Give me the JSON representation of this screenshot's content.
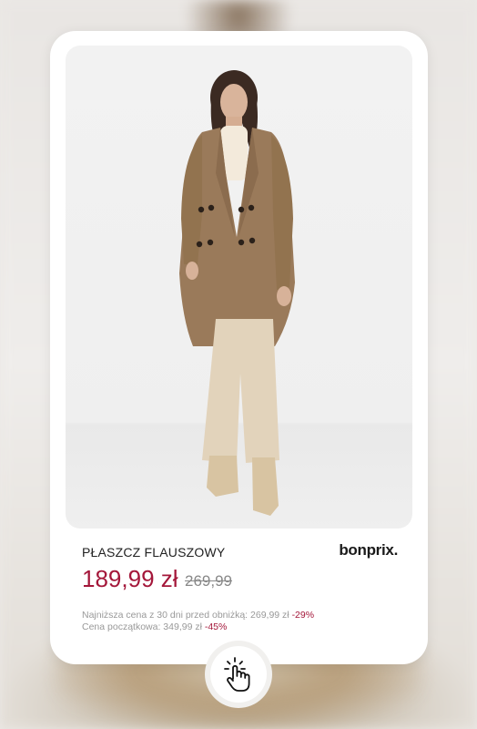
{
  "product": {
    "name": "PŁASZCZ FLAUSZOWY",
    "brand": "bonprix.",
    "price": "189,99 zł",
    "old_price": "269,99",
    "lowest_price_label": "Najniższa cena z 30 dni  przed obniżką: 269,99 zł",
    "lowest_price_discount": "-29%",
    "initial_price_label": "Cena początkowa: 349,99 zł",
    "initial_price_discount": "-45%",
    "image": "woman-in-camel-coat-photo"
  },
  "colors": {
    "accent": "#a4173a",
    "coat": "#9a7a5a",
    "pants": "#e2d3bb",
    "boots": "#d8c4a2"
  },
  "icons": {
    "tap": "hand-pointer-tap-icon"
  }
}
